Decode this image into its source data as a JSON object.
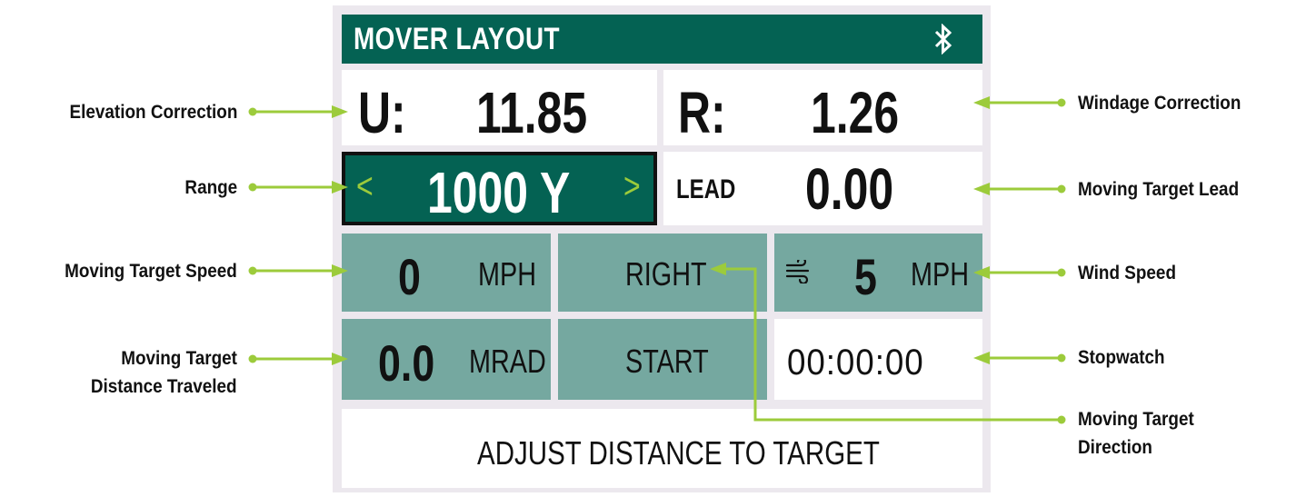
{
  "header": {
    "title": "MOVER LAYOUT",
    "status_icon": "bluetooth-icon"
  },
  "elevation": {
    "label": "U:",
    "value": "11.85"
  },
  "windage": {
    "label": "R:",
    "value": "1.26"
  },
  "range": {
    "value": "1000 Y",
    "prev_glyph": "<",
    "next_glyph": ">"
  },
  "lead": {
    "label": "LEAD",
    "value": "0.00"
  },
  "target_speed": {
    "value": "0",
    "unit": "MPH"
  },
  "direction": {
    "label": "RIGHT"
  },
  "wind": {
    "icon": "wind-icon",
    "value": "5",
    "unit": "MPH"
  },
  "distance": {
    "value": "0.0",
    "unit": "MRAD"
  },
  "start": {
    "label": "START"
  },
  "stopwatch": {
    "value": "00:00:00"
  },
  "message": {
    "text": "ADJUST DISTANCE TO TARGET"
  },
  "annotations": {
    "elevation": "Elevation Correction",
    "range": "Range",
    "target_speed": "Moving Target Speed",
    "distance_line1": "Moving Target",
    "distance_line2": "Distance Traveled",
    "windage": "Windage Correction",
    "lead": "Moving Target Lead",
    "wind": "Wind Speed",
    "stopwatch": "Stopwatch",
    "direction_line1": "Moving Target",
    "direction_line2": "Direction"
  },
  "colors": {
    "header": "#046253",
    "tile": "#75a8a0",
    "frame": "#ece8ee",
    "arrow": "#9ccb3b",
    "chevron": "#9ccb3b"
  }
}
